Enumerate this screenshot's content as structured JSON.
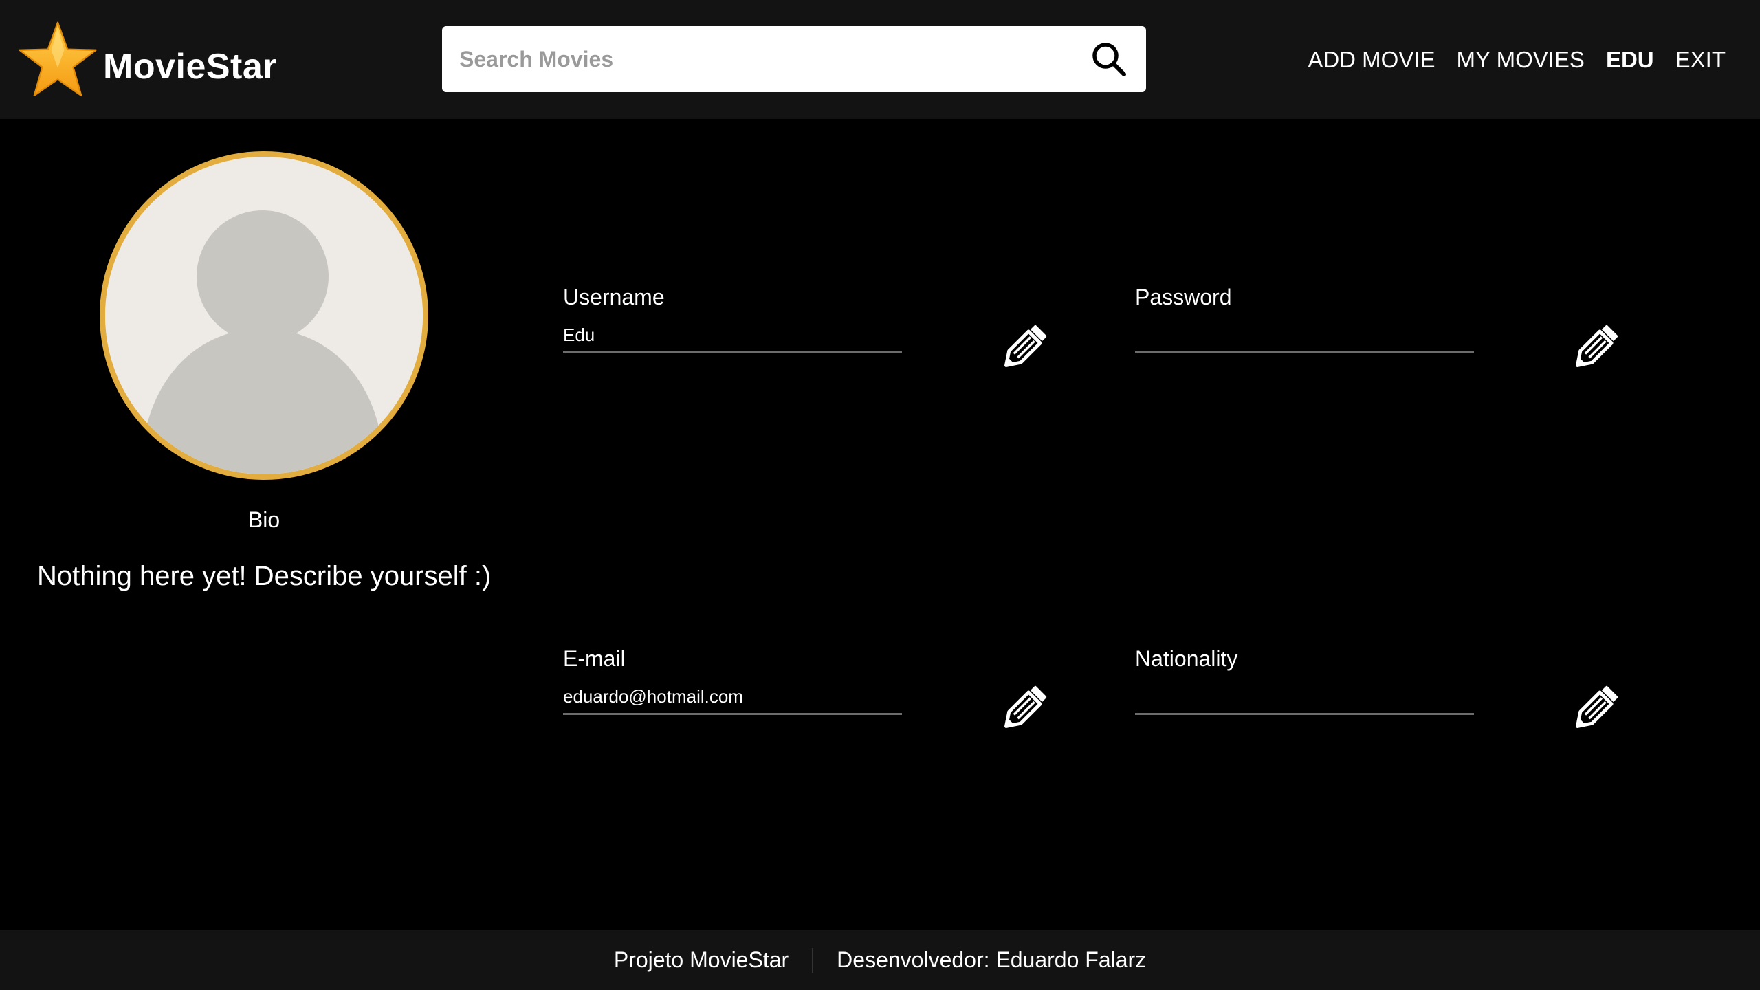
{
  "brand": {
    "name": "MovieStar",
    "star_color": "#fdb32a"
  },
  "search": {
    "placeholder": "Search Movies",
    "icon": "search-icon"
  },
  "nav": {
    "add_movie": "ADD MOVIE",
    "my_movies": "MY MOVIES",
    "user": "EDU",
    "exit": "EXIT"
  },
  "profile": {
    "avatar_border_color": "#e3ac3f",
    "bio_label": "Bio",
    "bio_text": "Nothing here yet! Describe yourself :)"
  },
  "fields": {
    "username": {
      "label": "Username",
      "value": "Edu"
    },
    "password": {
      "label": "Password",
      "value": ""
    },
    "email": {
      "label": "E-mail",
      "value": "eduardo@hotmail.com"
    },
    "nationality": {
      "label": "Nationality",
      "value": ""
    },
    "edit_icon": "pencil-icon"
  },
  "footer": {
    "project": "Projeto MovieStar",
    "developer": "Desenvolvedor: Eduardo Falarz"
  }
}
